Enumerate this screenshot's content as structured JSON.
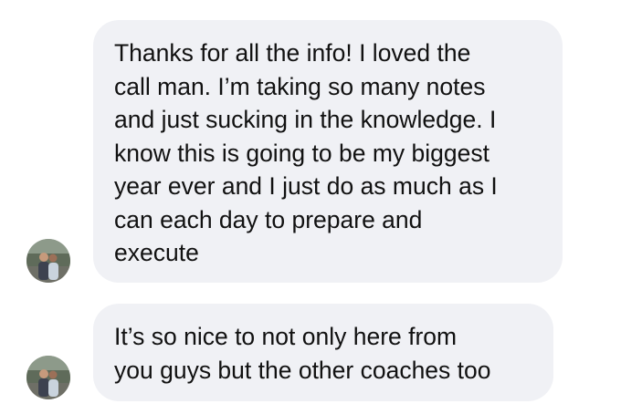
{
  "conversation": {
    "messages": [
      {
        "lines": [
          "Thanks for all the info! I loved the",
          "call man. I’m taking so many notes",
          "and just sucking in the knowledge. I",
          "know this is going to be my biggest",
          "year ever and I just do as much as I",
          "can each day to prepare and",
          "execute"
        ]
      },
      {
        "lines": [
          "It’s so nice to not only here from",
          "you guys but the other coaches too"
        ]
      }
    ]
  },
  "colors": {
    "bubble_background": "#f0f1f5",
    "text": "#111111",
    "page_background": "#ffffff"
  },
  "icons": {
    "avatar": "profile-photo-avatar"
  }
}
